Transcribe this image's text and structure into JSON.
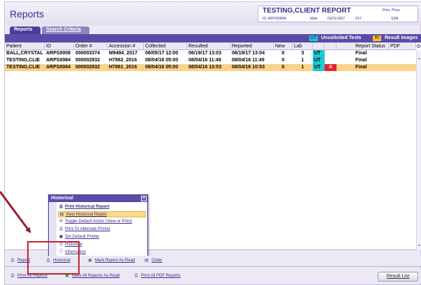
{
  "app": {
    "title": "Reports"
  },
  "patient": {
    "name": "TESTING,CLIENT REPORT",
    "id": "ID: ARP300846",
    "sex": "Male",
    "dob": "01/01/1957",
    "age": "61Y",
    "prim_phys_label": "Prim. Phys:",
    "prim_phys_value": "SSN:"
  },
  "tabs": [
    {
      "label": "Reports",
      "active": true
    },
    {
      "label": "Search Criteria",
      "active": false
    }
  ],
  "legend": {
    "ut_badge": "UT",
    "ut_label": "Unsolicited Tests",
    "ri_badge": "RI",
    "ri_label": "Result Images",
    "colors": {
      "ut": "#1ec8d6",
      "ri": "#f3c52a",
      "abnormal": "#e8222b",
      "selected_row": "#fad28b",
      "accent": "#5a4ba8"
    }
  },
  "grid": {
    "columns": [
      "Patient",
      "ID",
      "Order #",
      "Accession #",
      "Collected",
      "Resulted",
      "Reported",
      "New",
      "Lab",
      "",
      "",
      "Report Status",
      "PDF"
    ],
    "rows": [
      {
        "patient": "BALL,CRYSTAL",
        "id": "ARPS0008",
        "order": "000003374",
        "accession": "M9484_2017",
        "collected": "06/05/17 12:00",
        "resulted": "06/19/17 13:03",
        "reported": "06/19/17 13:04",
        "new": "X",
        "lab": "3",
        "flag1": "UT",
        "flag2": "",
        "status": "Final",
        "pdf": "",
        "selected": false
      },
      {
        "patient": "TESTING,CLIE",
        "id": "ARPS0084",
        "order": "000002932",
        "accession": "H7862_2016",
        "collected": "08/04/16 05:00",
        "resulted": "08/04/16 11:49",
        "reported": "08/04/16 11:49",
        "new": "X",
        "lab": "1",
        "flag1": "UT",
        "flag2": "",
        "status": "Final",
        "pdf": "",
        "selected": false
      },
      {
        "patient": "TESTING,CLIE",
        "id": "ARPS0084",
        "order": "000002932",
        "accession": "H7861_2016",
        "collected": "08/04/16 05:00",
        "resulted": "08/04/16 10:53",
        "reported": "08/04/16 10:53",
        "new": "X",
        "lab": "1",
        "flag1": "UT",
        "flag2": "A",
        "status": "Final",
        "pdf": "",
        "selected": true
      }
    ]
  },
  "popup": {
    "title": "Historical",
    "close": "✕",
    "items": [
      {
        "label": "Print Historical Report",
        "icon": "printer-icon"
      },
      {
        "label": "View Historical Report",
        "icon": "document-icon"
      },
      {
        "label": "Toggle Default Action (View or Print)",
        "icon": "toggle-icon"
      },
      {
        "label": "Print To Alternate Printer",
        "icon": "printer-icon"
      },
      {
        "label": "Set Default Printer",
        "icon": "printer-set-icon"
      },
      {
        "label": "Historical",
        "icon": "history-icon"
      },
      {
        "label": "Information",
        "icon": "info-icon"
      }
    ]
  },
  "toolbar": {
    "report": "Report",
    "historical": "Historical",
    "mark_read": "Mark Report As Read",
    "order": "Order",
    "print_all": "Print All Reports",
    "mark_all_read": "Mark All Reports As Read",
    "print_all_pdf": "Print All PDF Reports",
    "result_list": "Result List"
  },
  "annotation": {
    "arrow_color": "#9b1b2e",
    "box_color": "#c0242b"
  }
}
